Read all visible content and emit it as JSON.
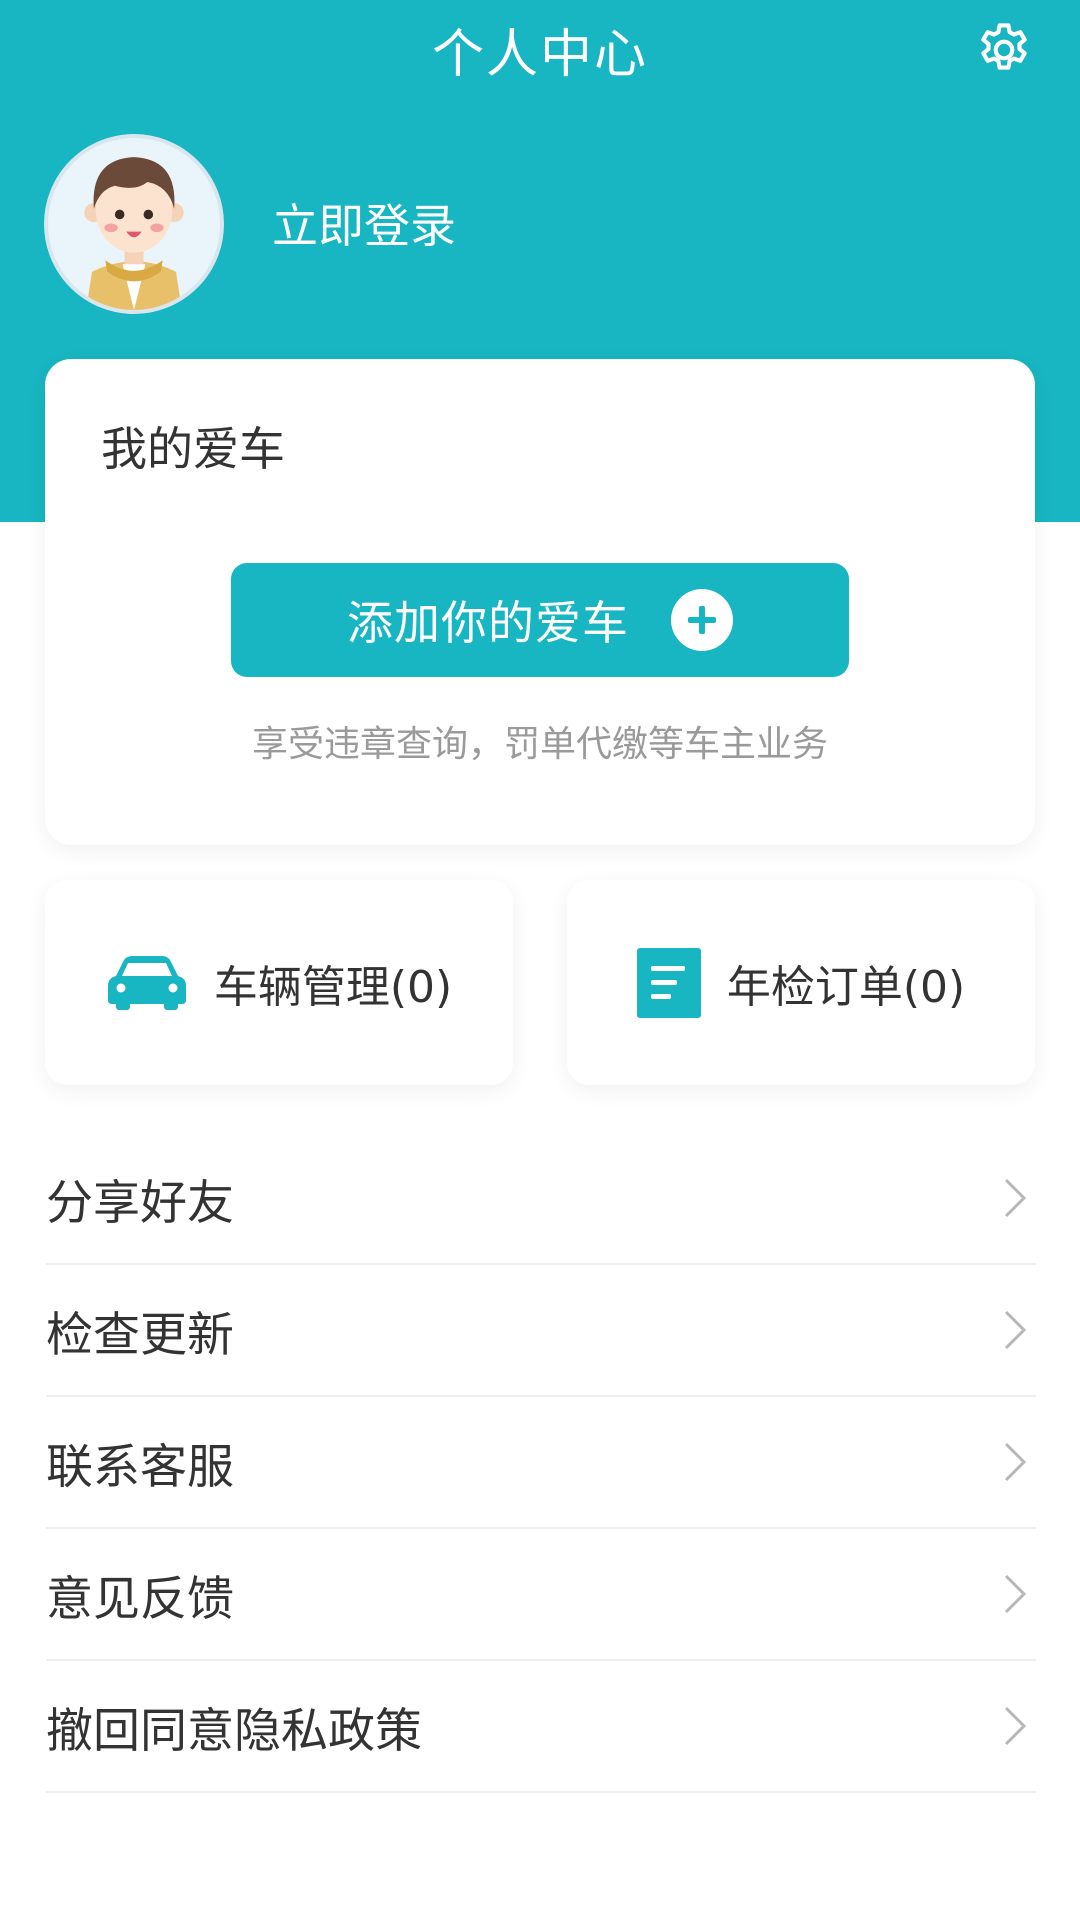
{
  "header": {
    "title": "个人中心",
    "settings_icon": "gear-icon",
    "login_label": "立即登录",
    "accent_color": "#17b6c2"
  },
  "car_card": {
    "title": "我的爱车",
    "add_button_label": "添加你的爱车",
    "add_icon": "plus-circle-icon",
    "description": "享受违章查询，罚单代缴等车主业务"
  },
  "quick_tiles": [
    {
      "label": "车辆管理(0)",
      "icon": "car-icon"
    },
    {
      "label": "年检订单(0)",
      "icon": "document-icon"
    }
  ],
  "menu": [
    {
      "label": "分享好友"
    },
    {
      "label": "检查更新"
    },
    {
      "label": "联系客服"
    },
    {
      "label": "意见反馈"
    },
    {
      "label": "撤回同意隐私政策"
    }
  ]
}
